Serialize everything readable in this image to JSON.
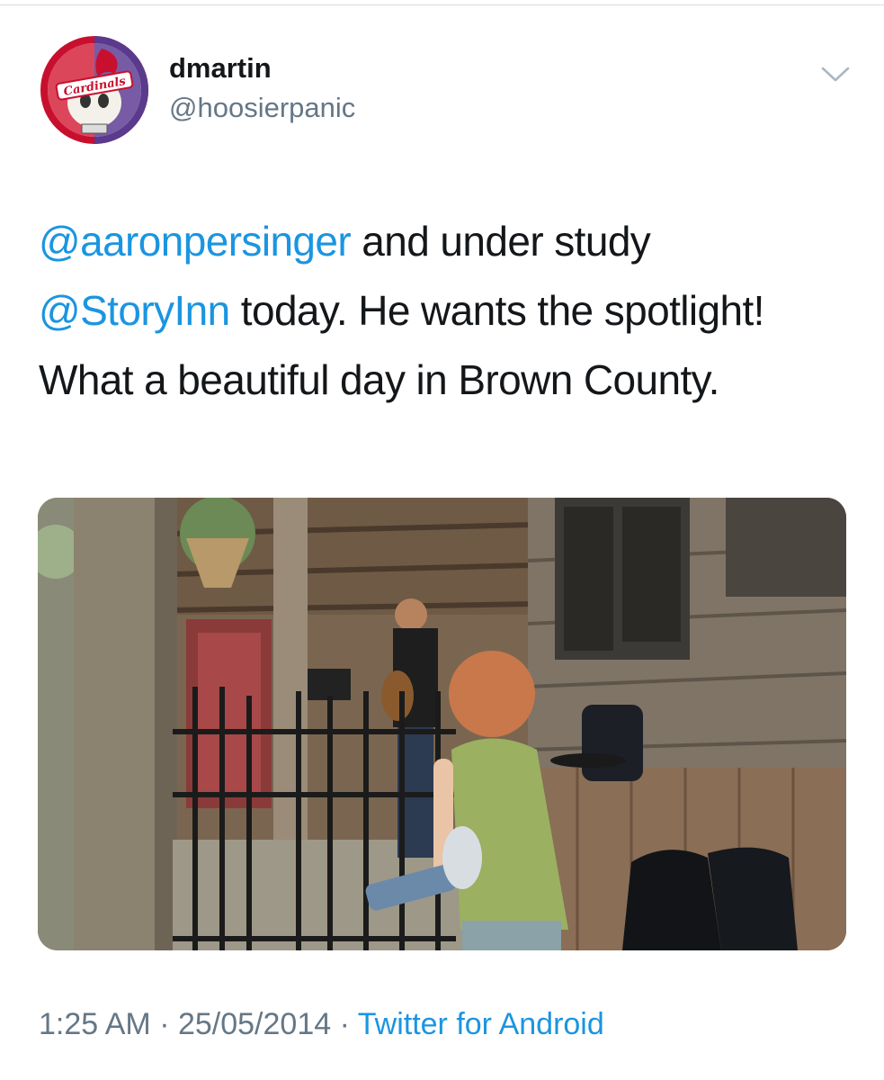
{
  "author": {
    "display_name": "dmartin",
    "handle": "@hoosierpanic",
    "avatar_icon": "cardinals-stealie-logo",
    "avatar_logo_text": "Cardinals"
  },
  "tweet": {
    "mention_1": "@aaronpersinger",
    "text_1": " and under study ",
    "mention_2": "@StoryInn",
    "text_2": " today. He wants the spotlight! What a beautiful day in Brown County."
  },
  "photo": {
    "description_icon": "tweet-photo"
  },
  "meta": {
    "time": "1:25 AM",
    "separator_1": " · ",
    "date": "25/05/2014",
    "separator_2": " · ",
    "source": "Twitter for Android"
  },
  "colors": {
    "link": "#1b95e0",
    "secondary": "#657786",
    "primary": "#14171a"
  }
}
